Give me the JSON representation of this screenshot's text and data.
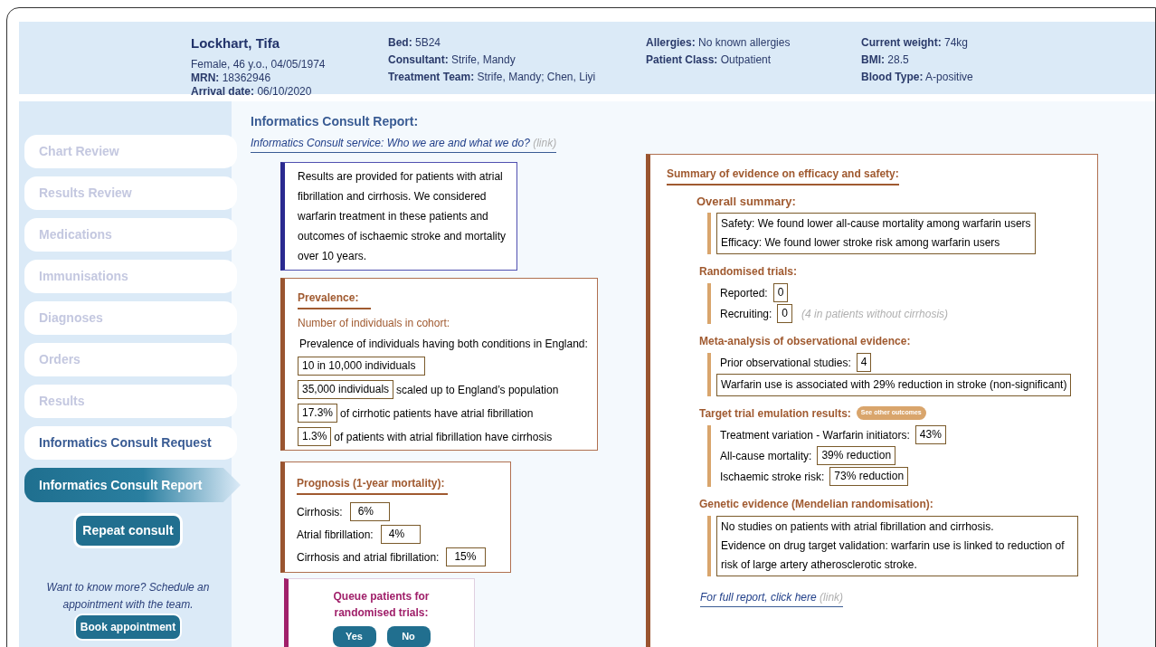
{
  "patient": {
    "name": "Lockhart, Tifa",
    "details": "Female, 46 y.o., 04/05/1974",
    "columns": [
      [
        {
          "label": "MRN:",
          "value": "18362946"
        },
        {
          "label": "Arrival date:",
          "value": "06/10/2020"
        }
      ],
      [
        {
          "label": "Bed:",
          "value": "5B24"
        },
        {
          "label": "Consultant:",
          "value": "Strife, Mandy"
        },
        {
          "label": "Treatment Team:",
          "value": "Strife, Mandy; Chen, Liyi"
        }
      ],
      [
        {
          "label": "Allergies:",
          "value": "No known allergies"
        },
        {
          "label": "Patient Class:",
          "value": "Outpatient"
        }
      ],
      [
        {
          "label": "Current weight:",
          "value": "74kg"
        },
        {
          "label": "BMI:",
          "value": "28.5"
        },
        {
          "label": "Blood Type:",
          "value": "A-positive"
        }
      ]
    ]
  },
  "sidebar": {
    "items": [
      {
        "label": "Chart Review",
        "disabled": true,
        "selected": false
      },
      {
        "label": "Results Review",
        "disabled": true,
        "selected": false
      },
      {
        "label": "Medications",
        "disabled": true,
        "selected": false
      },
      {
        "label": "Immunisations",
        "disabled": true,
        "selected": false
      },
      {
        "label": "Diagnoses",
        "disabled": true,
        "selected": false
      },
      {
        "label": "Orders",
        "disabled": true,
        "selected": false
      },
      {
        "label": "Results",
        "disabled": true,
        "selected": false
      },
      {
        "label": "Informatics Consult Request",
        "disabled": false,
        "selected": false
      },
      {
        "label": "Informatics Consult Report",
        "disabled": false,
        "selected": true
      }
    ],
    "repeat_button": "Repeat consult",
    "more_text": "Want to know more? Schedule an appointment with the team.",
    "book_button": "Book appointment"
  },
  "report": {
    "title": "Informatics Consult Report:",
    "service_link": {
      "text": "Informatics Consult service: Who we are and what we do?",
      "hint": "(link)"
    },
    "intro": "Results are provided for patients with atrial fibrillation and cirrhosis. We considered warfarin treatment in these patients and outcomes of ischaemic stroke and mortality over 10 years.",
    "prevalence": {
      "title": "Prevalence:",
      "subtitle": "Number of individuals in cohort:",
      "text": "Prevalence of individuals having both conditions in England:",
      "rows": [
        {
          "value": "10 in 10,000 individuals"
        },
        {
          "value": "35,000 individuals",
          "text": "scaled up to England’s population"
        },
        {
          "value": "17.3%",
          "text": "of cirrhotic patients have atrial fibrillation"
        },
        {
          "value": "1.3%",
          "text": "of patients with atrial fibrillation have cirrhosis"
        }
      ]
    },
    "prognosis": {
      "title": "Prognosis (1-year mortality):",
      "rows": [
        {
          "label": "Cirrhosis:",
          "value": "6%"
        },
        {
          "label": "Atrial fibrillation:",
          "value": "4%"
        },
        {
          "label": "Cirrhosis and atrial fibrillation:",
          "value": "15%"
        }
      ]
    },
    "queue": {
      "title": "Queue patients for randomised trials:",
      "buttons": [
        "Yes",
        "No"
      ]
    },
    "summary": {
      "title": "Summary of evidence on efficacy and safety:",
      "sections": [
        {
          "heading": "Overall summary:",
          "items": [
            {
              "kind": "box",
              "lines": [
                "Safety: We found lower all-cause mortality among warfarin users",
                "Efficacy: We found lower stroke risk among warfarin users"
              ]
            }
          ]
        },
        {
          "heading": "Randomised trials:",
          "items": [
            {
              "kind": "row",
              "label": "Reported:",
              "value": "0"
            },
            {
              "kind": "row",
              "label": "Recruiting:",
              "value": "0",
              "note": "(4 in patients without cirrhosis)"
            }
          ]
        },
        {
          "heading": "Meta-analysis of observational evidence:",
          "items": [
            {
              "kind": "row",
              "label": "Prior observational studies:",
              "value": "4"
            },
            {
              "kind": "box",
              "lines": [
                "Warfarin use is associated with 29% reduction in stroke (non-significant)"
              ]
            }
          ]
        },
        {
          "heading": "Target trial emulation results:",
          "badge": "See other outcomes",
          "items": [
            {
              "kind": "row",
              "label": "Treatment variation - Warfarin initiators:",
              "value": "43%"
            },
            {
              "kind": "row",
              "label": "All-cause mortality:",
              "value": "39% reduction"
            },
            {
              "kind": "row",
              "label": "Ischaemic stroke risk:",
              "value": "73% reduction"
            }
          ]
        },
        {
          "heading": "Genetic evidence (Mendelian randomisation):",
          "items": [
            {
              "kind": "box",
              "lines": [
                "No studies on patients with atrial fibrillation and cirrhosis.",
                "Evidence on drug target validation: warfarin use is linked to reduction of risk of large artery atherosclerotic stroke."
              ]
            }
          ]
        }
      ],
      "full_link": {
        "text": "For full report, click here",
        "hint": "(link)"
      }
    }
  }
}
